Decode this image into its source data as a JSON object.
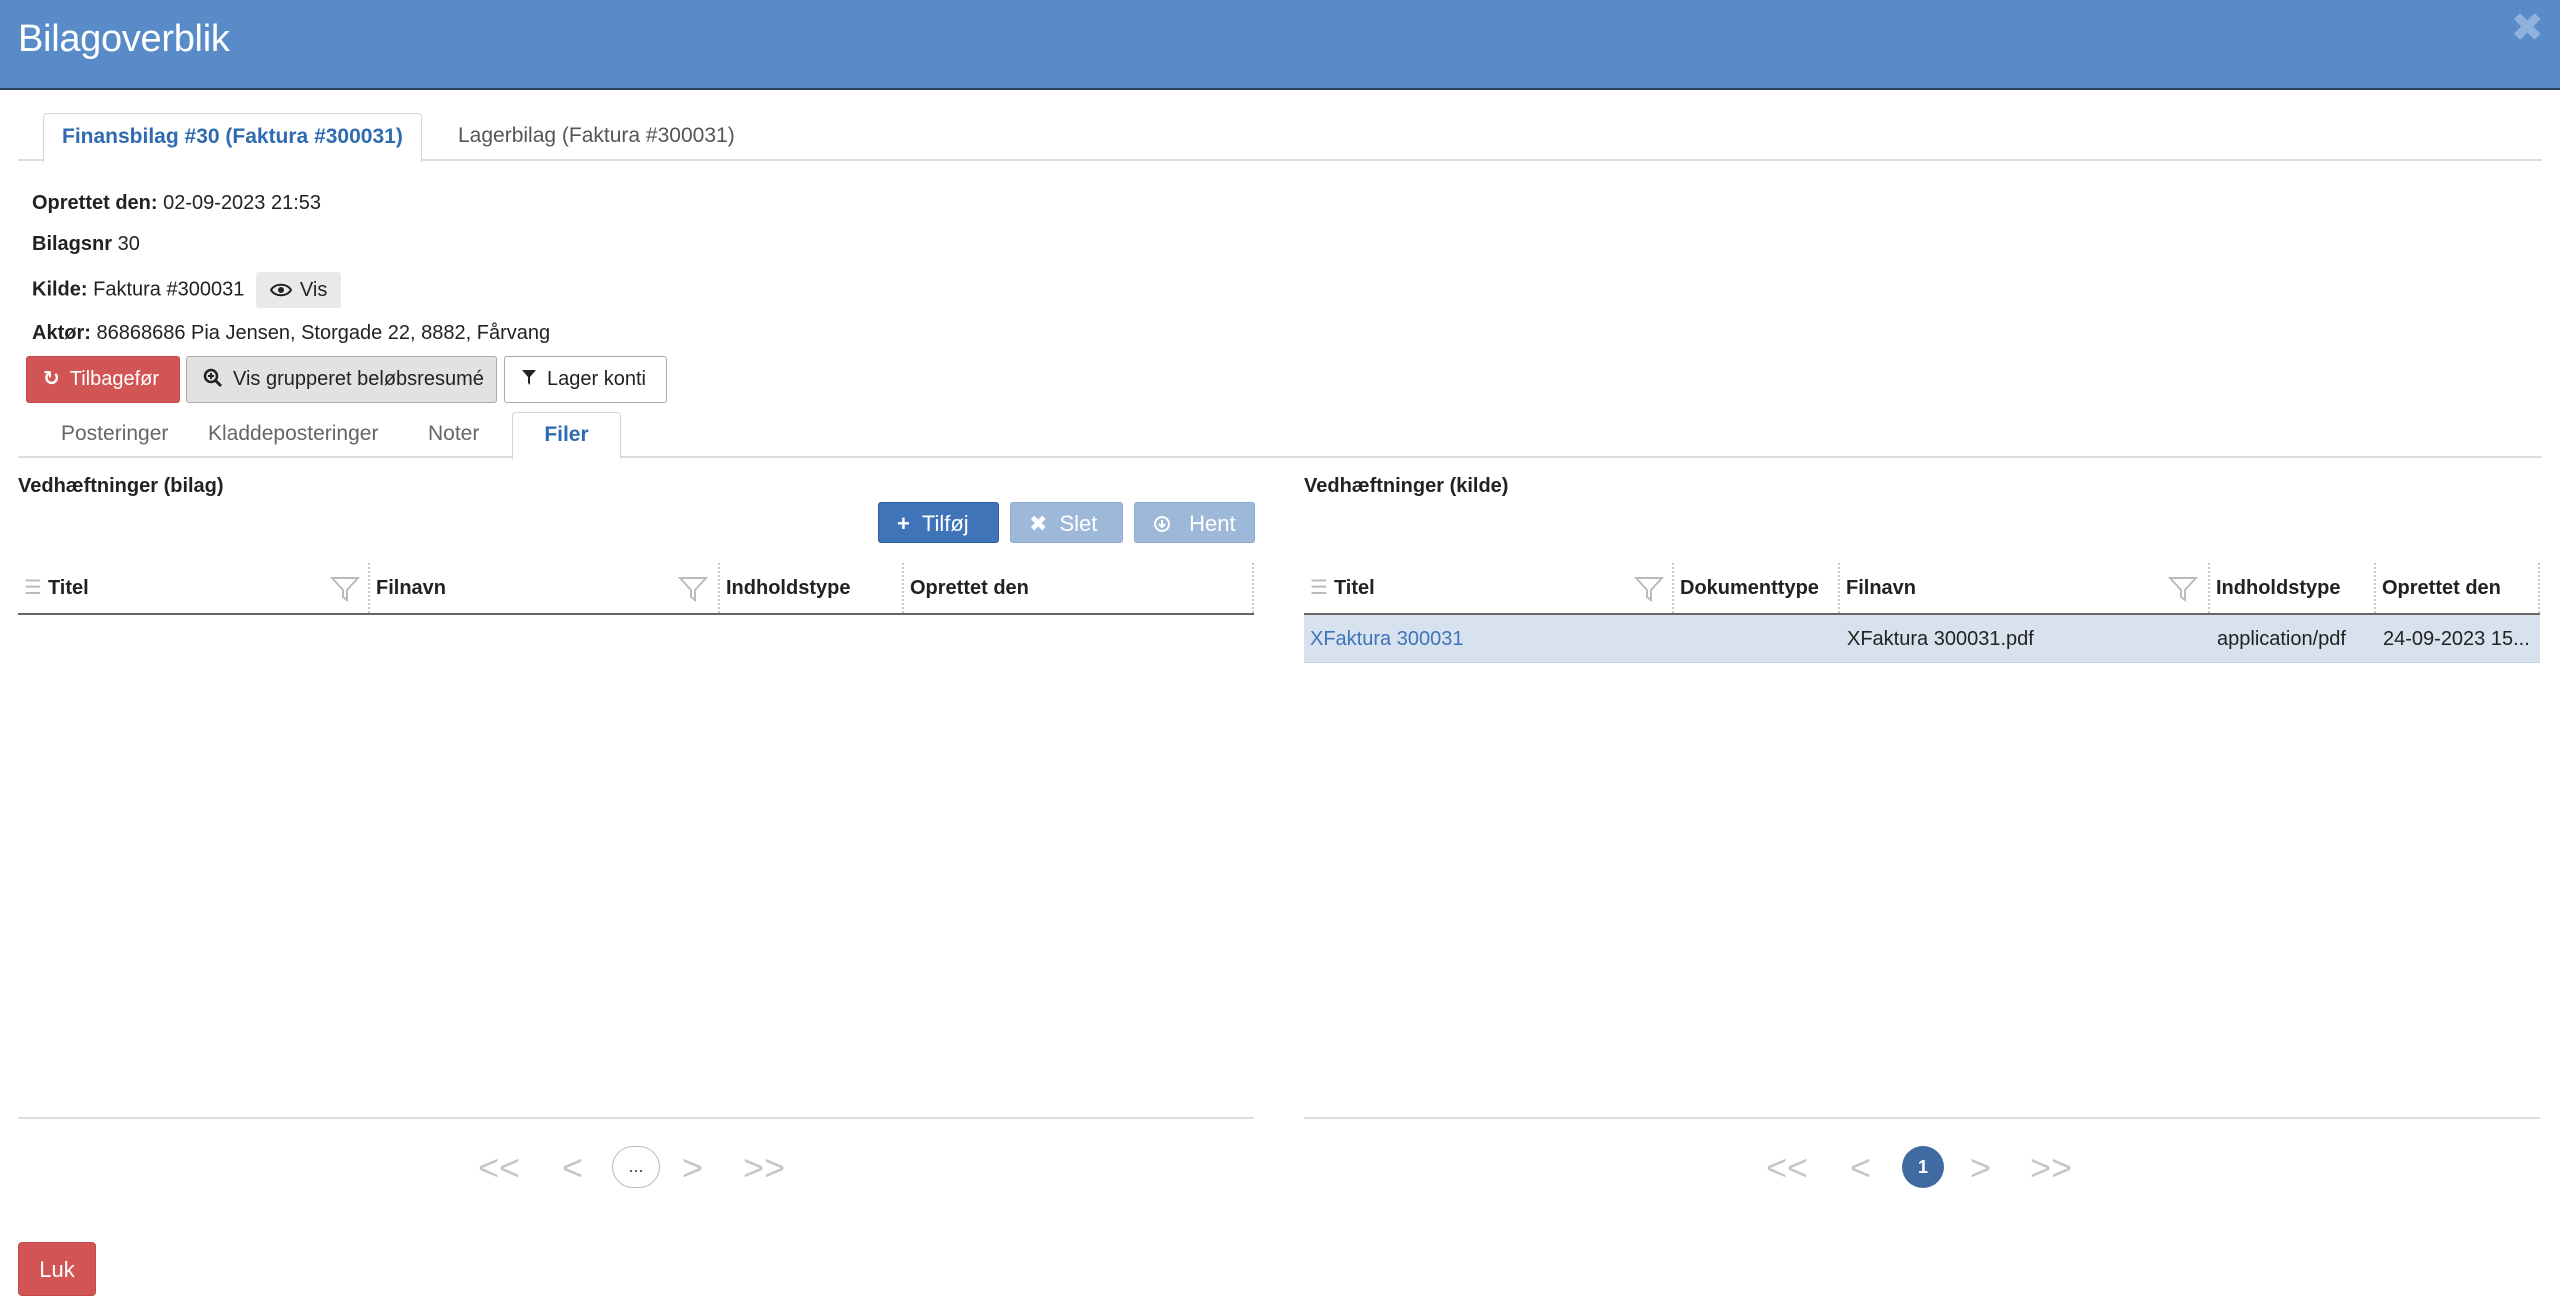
{
  "window": {
    "title": "Bilagoverblik",
    "close_symbol": "✖"
  },
  "main_tabs": [
    {
      "label": "Finansbilag #30 (Faktura #300031)",
      "active": true
    },
    {
      "label": "Lagerbilag (Faktura #300031)",
      "active": false
    }
  ],
  "info": {
    "created_label": "Oprettet den:",
    "created_value": "02-09-2023 21:53",
    "bilagsnr_label": "Bilagsnr",
    "bilagsnr_value": "30",
    "kilde_label": "Kilde:",
    "kilde_value": "Faktura #300031",
    "vis_label": "Vis",
    "aktor_label": "Aktør:",
    "aktor_value": "86868686 Pia Jensen, Storgade 22, 8882, Fårvang"
  },
  "actions": {
    "tilbagefor": "Tilbagefør",
    "vis_grupperet": "Vis grupperet beløbsresumé",
    "lager_konti": "Lager konti"
  },
  "sub_tabs": [
    {
      "label": "Posteringer",
      "active": false
    },
    {
      "label": "Kladdeposteringer",
      "active": false
    },
    {
      "label": "Noter",
      "active": false
    },
    {
      "label": "Filer",
      "active": true
    }
  ],
  "left_panel": {
    "title": "Vedhæftninger (bilag)",
    "toolbar": {
      "add": "Tilføj",
      "delete": "Slet",
      "fetch": "Hent"
    },
    "columns": [
      "Titel",
      "Filnavn",
      "Indholdstype",
      "Oprettet den"
    ],
    "rows": [],
    "pager": {
      "first": "<<",
      "prev": "<",
      "page": "...",
      "next": ">",
      "last": ">>"
    }
  },
  "right_panel": {
    "title": "Vedhæftninger (kilde)",
    "columns": [
      "Titel",
      "Dokumenttype",
      "Filnavn",
      "Indholdstype",
      "Oprettet den"
    ],
    "rows": [
      {
        "titel": "XFaktura 300031",
        "dokumenttype": "",
        "filnavn": "XFaktura 300031.pdf",
        "indholdstype": "application/pdf",
        "oprettet": "24-09-2023 15..."
      }
    ],
    "pager": {
      "first": "<<",
      "prev": "<",
      "page": "1",
      "next": ">",
      "last": ">>"
    }
  },
  "footer": {
    "close_label": "Luk"
  }
}
